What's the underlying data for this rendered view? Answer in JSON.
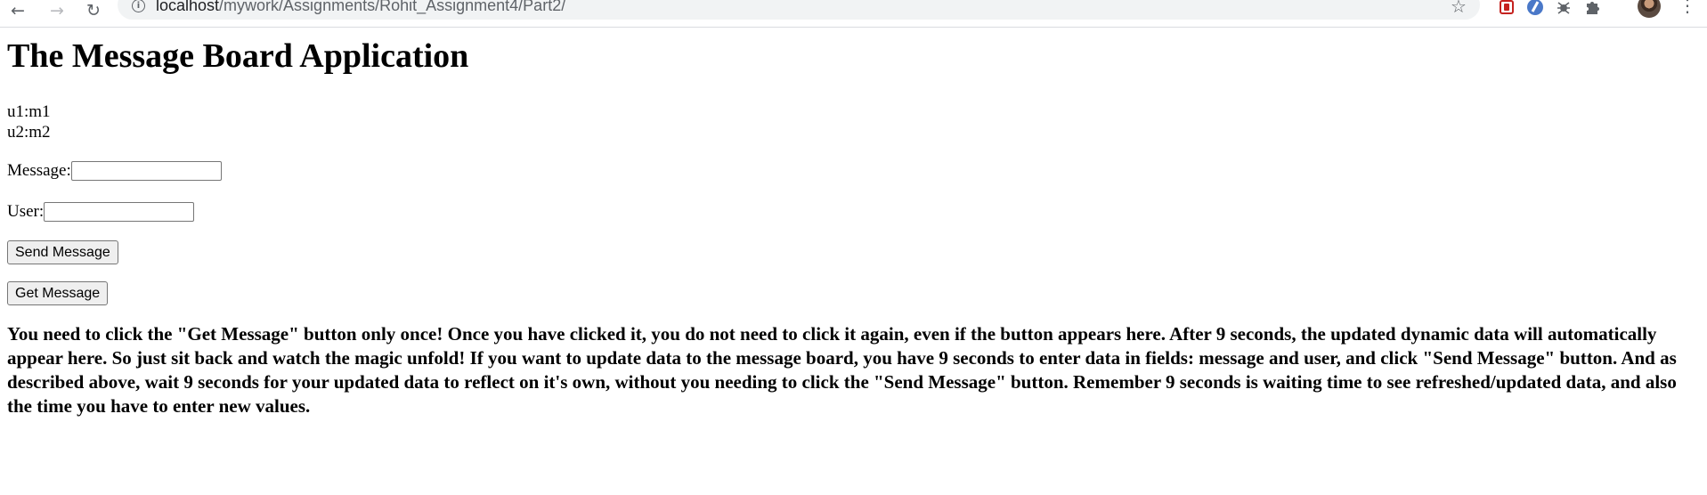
{
  "browser": {
    "url_host": "localhost",
    "url_path": "/mywork/Assignments/Rohit_Assignment4/Part2/",
    "icons": [
      "back-icon",
      "forward-icon",
      "reload-icon",
      "info-icon",
      "bookmark-star-icon",
      "extension-icon",
      "puzzle-icon",
      "more-icon"
    ]
  },
  "page": {
    "title": "The Message Board Application",
    "messages": [
      "u1:m1",
      "u2:m2"
    ],
    "message_label": "Message:",
    "message_value": "",
    "user_label": "User:",
    "user_value": "",
    "send_label": "Send Message",
    "get_label": "Get Message",
    "note": "You need to click the \"Get Message\" button only once! Once you have clicked it, you do not need to click it again, even if the button appears here. After 9 seconds, the updated dynamic data will automatically appear here. So just sit back and watch the magic unfold! If you want to update data to the message board, you have 9 seconds to enter data in fields: message and user, and click \"Send Message\" button. And as described above, wait 9 seconds for your updated data to reflect on it's own, without you needing to click the \"Send Message\" button. Remember 9 seconds is waiting time to see refreshed/updated data, and also the time you have to enter new values."
  }
}
